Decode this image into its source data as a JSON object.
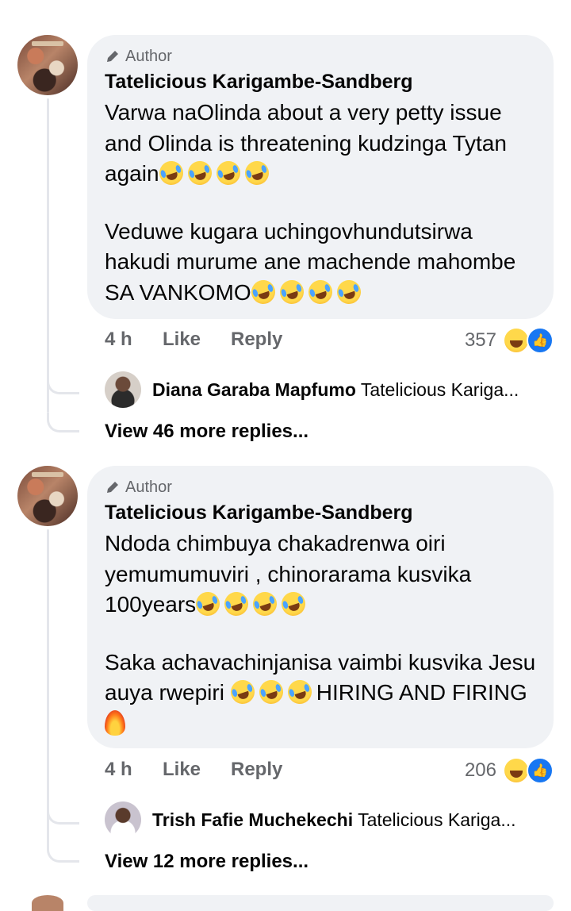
{
  "comments": [
    {
      "badge": "Author",
      "name": "Tatelicious Karigambe-Sandberg",
      "text_p1": "Varwa naOlinda about a very petty issue and Olinda is threatening kudzinga Tytan again",
      "text_p2": "Veduwe kugara uchingovhundutsirwa hakudi murume ane machende mahombe SA VANKOMO",
      "time": "4 h",
      "like": "Like",
      "reply": "Reply",
      "reaction_count": "357",
      "reply_preview": {
        "name": "Diana Garaba Mapfumo",
        "snippet": "Tatelicious Kariga..."
      },
      "view_more": "View 46 more replies..."
    },
    {
      "badge": "Author",
      "name": "Tatelicious Karigambe-Sandberg",
      "text_p1": "Ndoda chimbuya chakadrenwa oiri yemumumuviri , chinorarama kusvika 100years",
      "text_p2a": "Saka achavachinjanisa vaimbi kusvika Jesu auya rwepiri",
      "text_p2b": "HIRING AND FIRING",
      "time": "4 h",
      "like": "Like",
      "reply": "Reply",
      "reaction_count": "206",
      "reply_preview": {
        "name": "Trish Fafie Muchekechi",
        "snippet": "Tatelicious Kariga..."
      },
      "view_more": "View 12 more replies..."
    }
  ],
  "icons": {
    "author_badge": "pencil-icon",
    "laugh_emoji": "rolling-on-floor-laughing-emoji",
    "fire_emoji": "fire-emoji",
    "reaction_haha": "haha-reaction-icon",
    "reaction_like": "like-reaction-icon"
  },
  "colors": {
    "bubble": "#f0f2f5",
    "secondary_text": "#65676b",
    "like_blue": "#1877f2"
  }
}
